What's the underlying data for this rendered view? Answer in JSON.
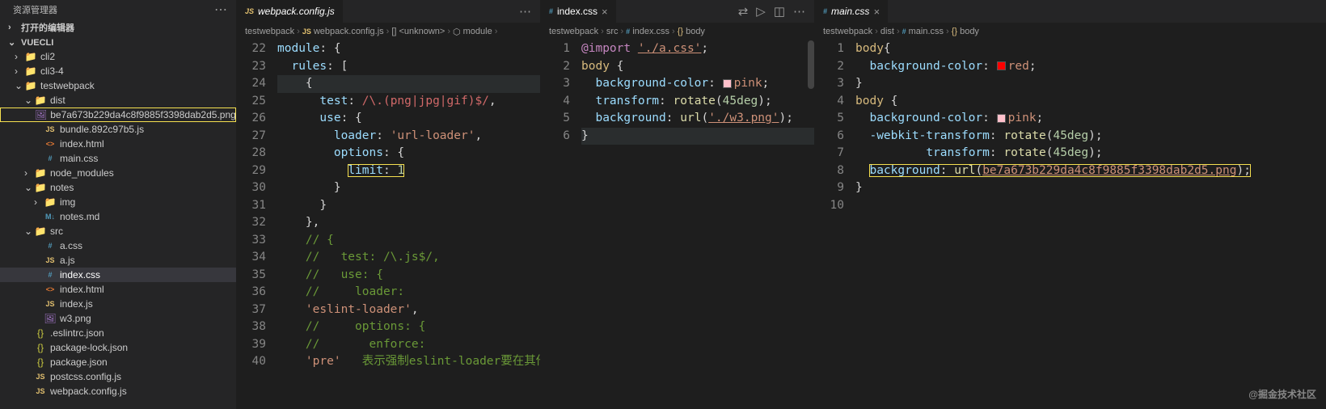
{
  "sidebar": {
    "title": "资源管理器",
    "open_editors": "打开的编辑器",
    "root": "VUECLI",
    "tree": [
      {
        "d": 1,
        "tw": "›",
        "icon": "folder",
        "label": "cli2"
      },
      {
        "d": 1,
        "tw": "›",
        "icon": "folder",
        "label": "cli3-4"
      },
      {
        "d": 1,
        "tw": "⌄",
        "icon": "folder",
        "label": "testwebpack"
      },
      {
        "d": 2,
        "tw": "⌄",
        "icon": "folder-dist",
        "label": "dist"
      },
      {
        "d": 3,
        "tw": "",
        "icon": "img",
        "label": "be7a673b229da4c8f9885f3398dab2d5.png",
        "hl": true
      },
      {
        "d": 3,
        "tw": "",
        "icon": "js",
        "label": "bundle.892c97b5.js"
      },
      {
        "d": 3,
        "tw": "",
        "icon": "html",
        "label": "index.html"
      },
      {
        "d": 3,
        "tw": "",
        "icon": "css",
        "label": "main.css"
      },
      {
        "d": 2,
        "tw": "›",
        "icon": "folder-node",
        "label": "node_modules"
      },
      {
        "d": 2,
        "tw": "⌄",
        "icon": "folder",
        "label": "notes"
      },
      {
        "d": 3,
        "tw": "›",
        "icon": "folder",
        "label": "img"
      },
      {
        "d": 3,
        "tw": "",
        "icon": "md",
        "label": "notes.md"
      },
      {
        "d": 2,
        "tw": "⌄",
        "icon": "folder",
        "label": "src"
      },
      {
        "d": 3,
        "tw": "",
        "icon": "css",
        "label": "a.css"
      },
      {
        "d": 3,
        "tw": "",
        "icon": "js",
        "label": "a.js"
      },
      {
        "d": 3,
        "tw": "",
        "icon": "css",
        "label": "index.css",
        "sel": true
      },
      {
        "d": 3,
        "tw": "",
        "icon": "html",
        "label": "index.html"
      },
      {
        "d": 3,
        "tw": "",
        "icon": "js",
        "label": "index.js"
      },
      {
        "d": 3,
        "tw": "",
        "icon": "img",
        "label": "w3.png"
      },
      {
        "d": 2,
        "tw": "",
        "icon": "json",
        "label": ".eslintrc.json"
      },
      {
        "d": 2,
        "tw": "",
        "icon": "json",
        "label": "package-lock.json"
      },
      {
        "d": 2,
        "tw": "",
        "icon": "json",
        "label": "package.json"
      },
      {
        "d": 2,
        "tw": "",
        "icon": "js",
        "label": "postcss.config.js"
      },
      {
        "d": 2,
        "tw": "",
        "icon": "js",
        "label": "webpack.config.js"
      }
    ]
  },
  "pane1": {
    "tab": "webpack.config.js",
    "crumbs": [
      "testwebpack",
      "webpack.config.js",
      "<unknown>",
      "module"
    ],
    "lines": {
      "start": 22,
      "rows": [
        {
          "n": 22,
          "html": "<span class='tk-key'>module</span><span class='tk-pun'>: {</span>"
        },
        {
          "n": 23,
          "html": "  <span class='tk-key'>rules</span><span class='tk-pun'>: [</span>"
        },
        {
          "n": 24,
          "html": "    <span class='tk-pun'>{</span>",
          "cl": true
        },
        {
          "n": 25,
          "html": "      <span class='tk-key'>test</span><span class='tk-pun'>: </span><span class='tk-reg'>/\\.(png|jpg|gif)$/</span><span class='tk-pun'>,</span>"
        },
        {
          "n": 26,
          "html": "      <span class='tk-key'>use</span><span class='tk-pun'>: {</span>"
        },
        {
          "n": 27,
          "html": "        <span class='tk-key'>loader</span><span class='tk-pun'>: </span><span class='tk-str'>'url-loader'</span><span class='tk-pun'>,</span>"
        },
        {
          "n": 28,
          "html": "        <span class='tk-key'>options</span><span class='tk-pun'>: {</span>"
        },
        {
          "n": 29,
          "html": "          <span class='hl-box'><span class='tk-key'>limit</span><span class='tk-pun'>: </span><span class='tk-num'>1</span></span>"
        },
        {
          "n": 30,
          "html": "        <span class='tk-pun'>}</span>"
        },
        {
          "n": 31,
          "html": "      <span class='tk-pun'>}</span>"
        },
        {
          "n": 32,
          "html": "    <span class='tk-pun'>},</span>"
        },
        {
          "n": 33,
          "html": "    <span class='tk-com'>// {</span>"
        },
        {
          "n": 34,
          "html": "    <span class='tk-com'>//   test: /\\.js$/,</span>"
        },
        {
          "n": 35,
          "html": "    <span class='tk-com'>//   use: {</span>"
        },
        {
          "n": 36,
          "html": "    <span class='tk-com'>//     loader:</span>"
        },
        {
          "n": 37,
          "html": "    <span class='tk-str'>'eslint-loader'</span><span class='tk-pun'>,</span>"
        },
        {
          "n": 38,
          "html": "    <span class='tk-com'>//     options: {</span>"
        },
        {
          "n": 39,
          "html": "    <span class='tk-com'>//       enforce:</span>"
        },
        {
          "n": 40,
          "html": "    <span class='tk-str'>'pre'</span>   <span class='tk-com'>表示强制eslint-loader要在其他</span>"
        }
      ]
    }
  },
  "pane2": {
    "tab": "index.css",
    "crumbs": [
      "testwebpack",
      "src",
      "index.css",
      "body"
    ],
    "lines": [
      {
        "n": 1,
        "html": "<span class='tk-kw'>@import</span> <span class='tk-url'>'./a.css'</span><span class='tk-pun'>;</span>"
      },
      {
        "n": 2,
        "html": "<span class='tk-sel'>body</span> <span class='tk-pun'>{</span>"
      },
      {
        "n": 3,
        "html": "  <span class='tk-prop'>background-color</span><span class='tk-pun'>: </span><span class='swatch pink'></span><span class='tk-val'>pink</span><span class='tk-pun'>;</span>"
      },
      {
        "n": 4,
        "html": "  <span class='tk-prop'>transform</span><span class='tk-pun'>: </span><span class='tk-fn'>rotate</span><span class='tk-pun'>(</span><span class='tk-num'>45deg</span><span class='tk-pun'>);</span>"
      },
      {
        "n": 5,
        "html": "  <span class='tk-prop'>background</span><span class='tk-pun'>: </span><span class='tk-fn'>url</span><span class='tk-pun'>(</span><span class='tk-url'>'./w3.png'</span><span class='tk-pun'>);</span>"
      },
      {
        "n": 6,
        "html": "<span class='tk-pun'>}</span>",
        "cl": true
      }
    ]
  },
  "pane3": {
    "tab": "main.css",
    "crumbs": [
      "testwebpack",
      "dist",
      "main.css",
      "body"
    ],
    "lines": [
      {
        "n": 1,
        "html": "<span class='tk-sel'>body</span><span class='tk-pun'>{</span>"
      },
      {
        "n": 2,
        "html": "  <span class='tk-prop'>background-color</span><span class='tk-pun'>: </span><span class='swatch red'></span><span class='tk-val'>red</span><span class='tk-pun'>;</span>"
      },
      {
        "n": 3,
        "html": "<span class='tk-pun'>}</span>"
      },
      {
        "n": 4,
        "html": "<span class='tk-sel'>body</span> <span class='tk-pun'>{</span>"
      },
      {
        "n": 5,
        "html": "  <span class='tk-prop'>background-color</span><span class='tk-pun'>: </span><span class='swatch pink'></span><span class='tk-val'>pink</span><span class='tk-pun'>;</span>"
      },
      {
        "n": 6,
        "html": "  <span class='tk-prop'>-webkit-transform</span><span class='tk-pun'>: </span><span class='tk-fn'>rotate</span><span class='tk-pun'>(</span><span class='tk-num'>45deg</span><span class='tk-pun'>);</span>"
      },
      {
        "n": 7,
        "html": "          <span class='tk-prop'>transform</span><span class='tk-pun'>: </span><span class='tk-fn'>rotate</span><span class='tk-pun'>(</span><span class='tk-num'>45deg</span><span class='tk-pun'>);</span>"
      },
      {
        "n": 8,
        "html": "  <span class='hl-box'><span class='tk-prop'>background</span><span class='tk-pun'>: </span><span class='tk-fn'>url</span><span class='tk-pun'>(</span><span class='tk-url'>be7a673b229da4c8f9885f3398dab2d5.png</span><span class='tk-pun'>);</span></span>"
      },
      {
        "n": 9,
        "html": "<span class='tk-pun'>}</span>"
      },
      {
        "n": 10,
        "html": ""
      }
    ]
  },
  "watermark": "@掘金技术社区"
}
